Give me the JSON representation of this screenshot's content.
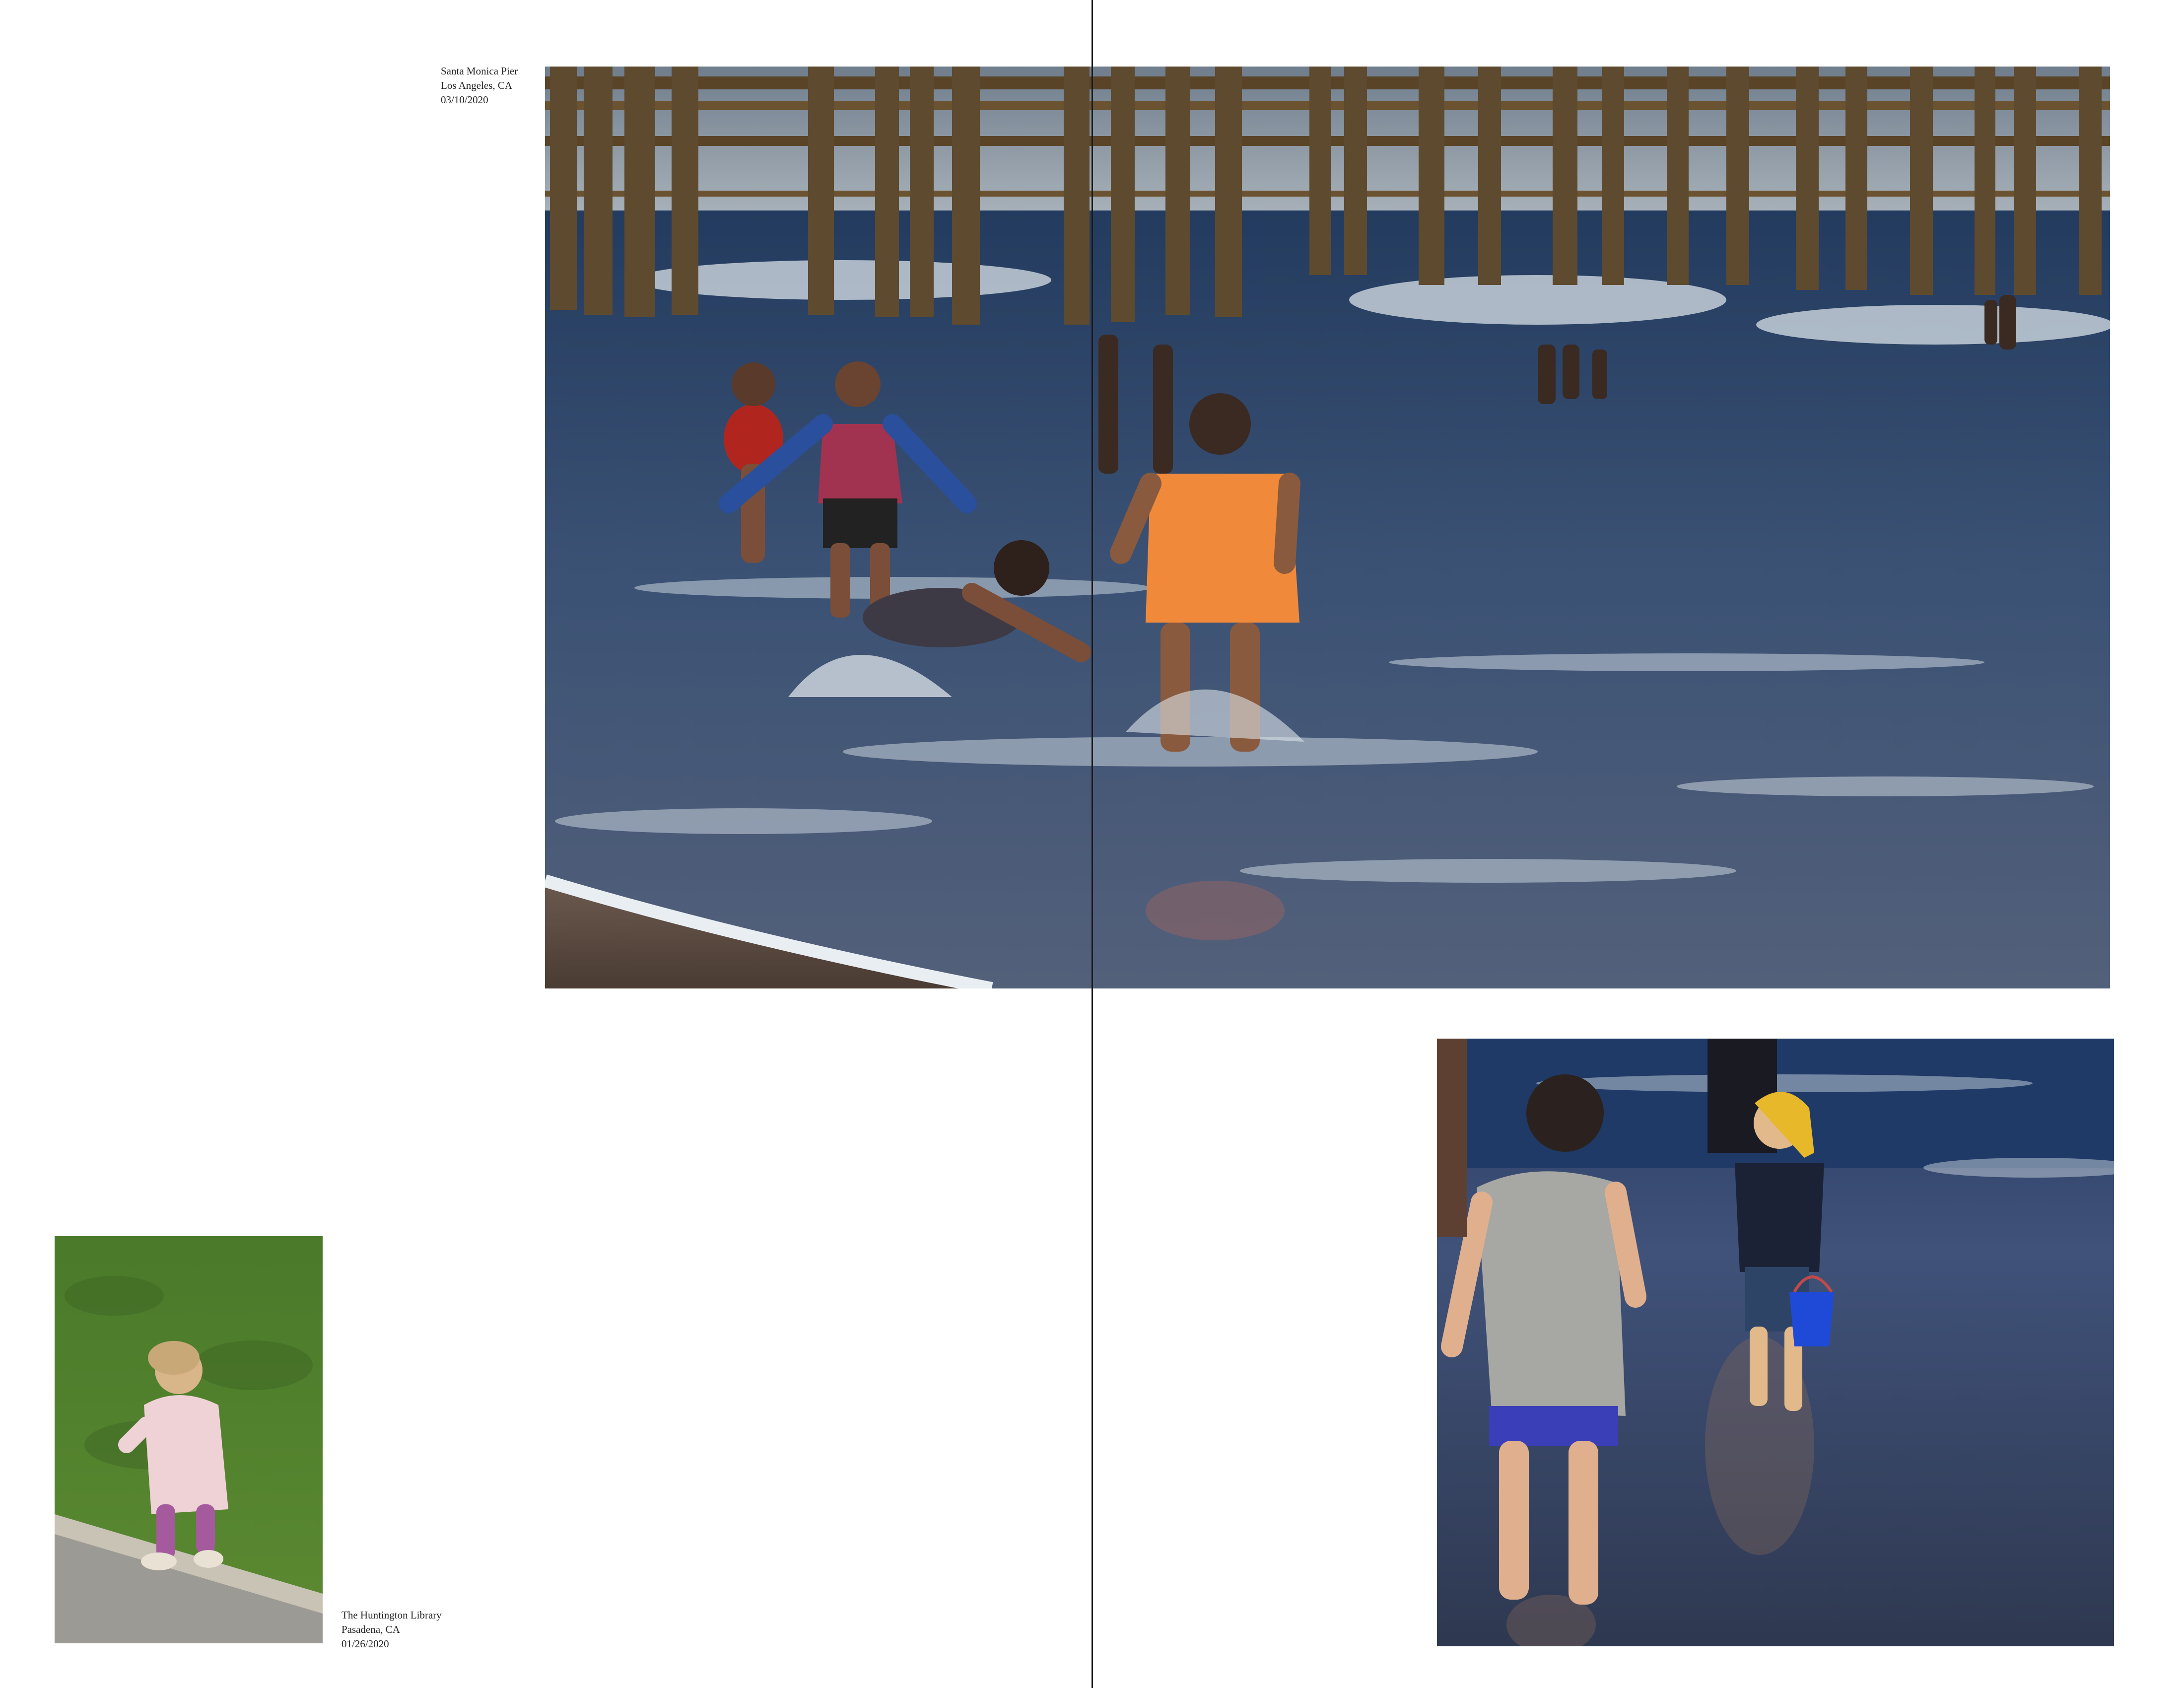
{
  "spread": {
    "photos": [
      {
        "id": "pier",
        "caption": {
          "place": "Santa Monica Pier",
          "city": "Los Angeles, CA",
          "date": "03/10/2020"
        }
      },
      {
        "id": "garden",
        "caption": {
          "place": "The Huntington Library",
          "city": "Pasadena, CA",
          "date": "01/26/2020"
        }
      },
      {
        "id": "boys",
        "caption": null
      }
    ]
  },
  "colors": {
    "ocean": "#334a6b",
    "pier_wood": "#6b5230",
    "sky": "#8c9aa8",
    "grass": "#4f7a2c",
    "sand_wet": "#35455e",
    "orange_shirt": "#f08a3a"
  }
}
